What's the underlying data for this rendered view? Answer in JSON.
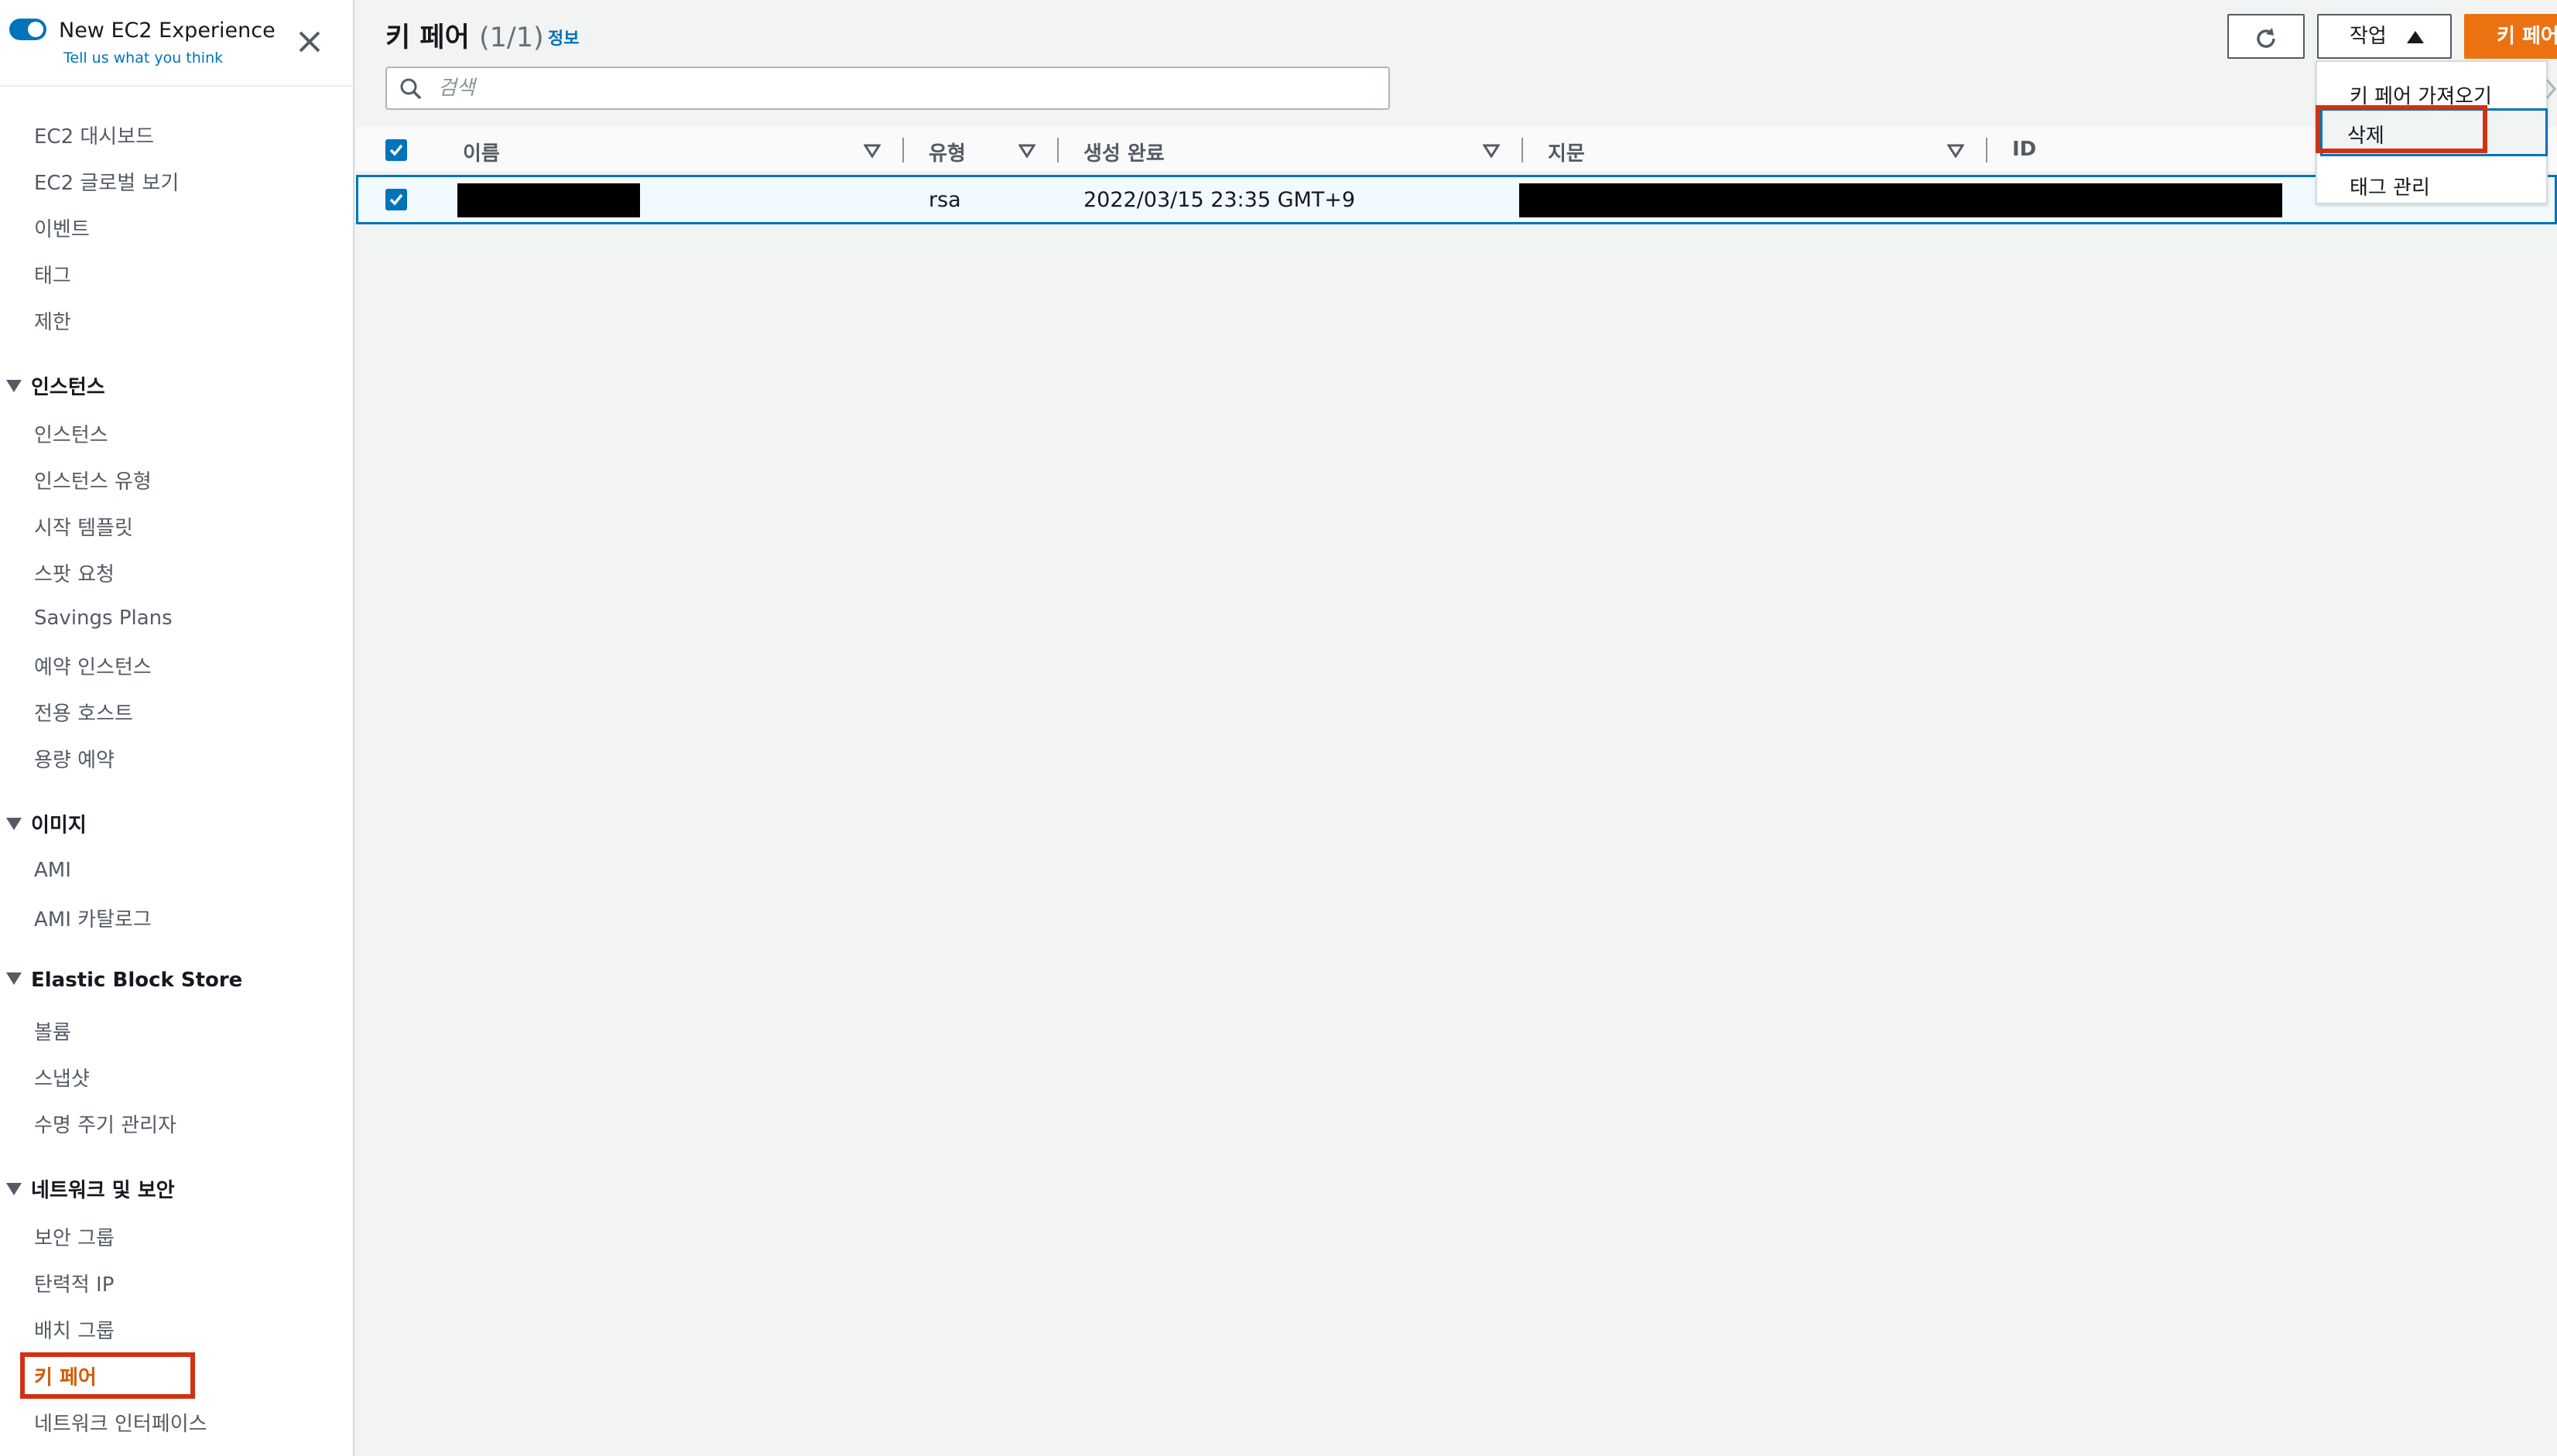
{
  "sidebar": {
    "experience": {
      "title": "New EC2 Experience",
      "subtitle": "Tell us what you think"
    },
    "top_items": [
      "EC2 대시보드",
      "EC2 글로벌 보기",
      "이벤트",
      "태그",
      "제한"
    ],
    "groups": [
      {
        "label": "인스턴스",
        "items": [
          "인스턴스",
          "인스턴스 유형",
          "시작 템플릿",
          "스팟 요청",
          "Savings Plans",
          "예약 인스턴스",
          "전용 호스트",
          "용량 예약"
        ]
      },
      {
        "label": "이미지",
        "items": [
          "AMI",
          "AMI 카탈로그"
        ]
      },
      {
        "label": "Elastic Block Store",
        "items": [
          "볼륨",
          "스냅샷",
          "수명 주기 관리자"
        ]
      },
      {
        "label": "네트워크 및 보안",
        "items": [
          "보안 그룹",
          "탄력적 IP",
          "배치 그룹",
          "키 페어",
          "네트워크 인터페이스"
        ]
      }
    ],
    "active_item": "키 페어"
  },
  "main": {
    "title": "키 페어",
    "count": "(1/1)",
    "info_link": "정보",
    "search_placeholder": "검색",
    "buttons": {
      "actions": "작업",
      "create": "키 페어 생성"
    },
    "actions_menu": [
      "키 페어 가져오기",
      "삭제",
      "태그 관리"
    ],
    "table": {
      "columns": [
        "이름",
        "유형",
        "생성 완료",
        "지문",
        "ID"
      ],
      "rows": [
        {
          "name": "",
          "type": "rsa",
          "created": "2022/03/15 23:35 GMT+9",
          "fingerprint": "",
          "id": ""
        }
      ]
    }
  },
  "colors": {
    "accent_blue": "#0073bb",
    "create_orange": "#ec7211",
    "highlight_red": "#d13212",
    "active_nav": "#d45b07"
  }
}
